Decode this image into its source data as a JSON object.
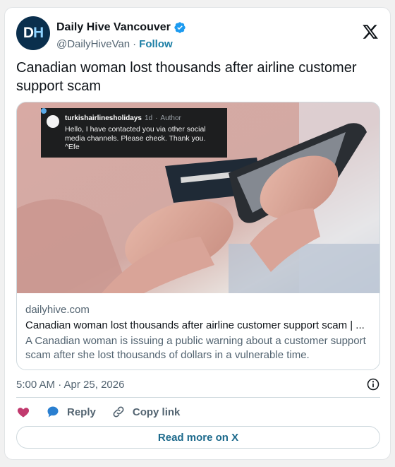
{
  "account": {
    "avatar_letter_1": "D",
    "avatar_letter_2": "H",
    "display_name": "Daily Hive Vancouver",
    "handle": "@DailyHiveVan",
    "separator": "·",
    "follow_label": "Follow"
  },
  "tweet": {
    "text": "Canadian woman lost thousands after airline customer support scam"
  },
  "media_overlay": {
    "account": "turkishairlinesholidays",
    "age": "1d",
    "separator": "·",
    "role": "Author",
    "message": "Hello, I have contacted you via other social media channels. Please check. Thank you. ^Efe"
  },
  "link_card": {
    "domain": "dailyhive.com",
    "title": "Canadian woman lost thousands after airline customer support scam | ...",
    "description": "A Canadian woman is issuing a public warning about a customer support scam after she lost thousands of dollars in a vulnerable time."
  },
  "meta": {
    "timestamp": "5:00 AM · Apr 25, 2026"
  },
  "actions": {
    "reply_label": "Reply",
    "copy_link_label": "Copy link",
    "read_more_label": "Read more on X"
  },
  "icons": {
    "verified": "verified-badge-icon",
    "platform": "x-logo-icon",
    "info": "info-icon",
    "like": "heart-icon",
    "reply": "speech-bubble-icon",
    "copy_link": "link-icon"
  },
  "colors": {
    "verified": "#1d9bf0",
    "follow": "#1d7fa6",
    "like": "#c13a6e",
    "reply": "#2a7fd0",
    "read_more": "#1d6a8c"
  }
}
